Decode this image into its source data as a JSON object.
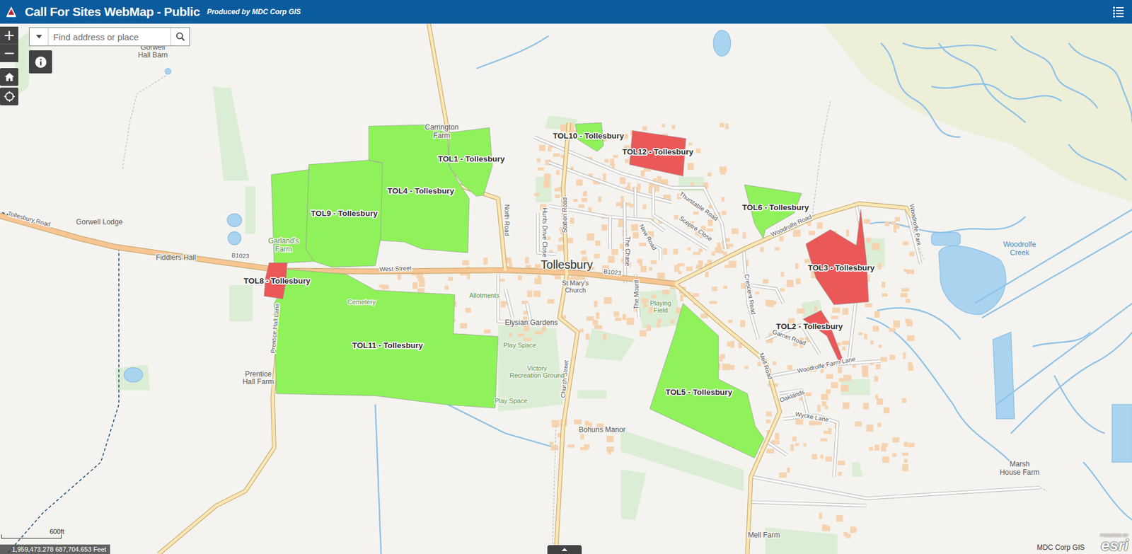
{
  "header": {
    "title": "Call For Sites WebMap - Public",
    "subtitle": "Produced by MDC Corp GIS"
  },
  "zoom": {
    "in": "+",
    "out": "−"
  },
  "search": {
    "placeholder": "Find address or place"
  },
  "sites": [
    {
      "label": "TOL1 - Tollesbury",
      "color": "#8ff25a"
    },
    {
      "label": "TOL4 - Tollesbury",
      "color": "#8ff25a"
    },
    {
      "label": "TOL9 - Tollesbury",
      "color": "#8ff25a"
    },
    {
      "label": "TOL11 - Tollesbury",
      "color": "#8ff25a"
    },
    {
      "label": "TOL8 - Tollesbury",
      "color": "#ea5858"
    },
    {
      "label": "TOL10 - Tollesbury",
      "color": "#8ff25a"
    },
    {
      "label": "TOL12 - Tollesbury",
      "color": "#ea5858"
    },
    {
      "label": "TOL6 - Tollesbury",
      "color": "#8ff25a"
    },
    {
      "label": "TOL3 - Tollesbury",
      "color": "#ea5858"
    },
    {
      "label": "TOL2 - Tollesbury",
      "color": "#ea5858"
    },
    {
      "label": "TOL5 - Tollesbury",
      "color": "#8ff25a"
    }
  ],
  "places": [
    {
      "lines": [
        "Gorwell",
        "Hall Barn"
      ],
      "color": "#5a5a5a"
    },
    {
      "lines": [
        "Carrington",
        "Farm"
      ],
      "color": "#5a5a5a"
    },
    {
      "lines": [
        "Gorwell Lodge"
      ],
      "color": "#5a5a5a"
    },
    {
      "lines": [
        "Fiddlers Hall"
      ],
      "color": "#5a5a5a"
    },
    {
      "lines": [
        "Garland's",
        "Farm"
      ],
      "color": "#5b9a4a"
    },
    {
      "lines": [
        "Tollesbury"
      ],
      "color": "#333333"
    },
    {
      "lines": [
        "St Mary's",
        "Church"
      ],
      "color": "#5a5a5a"
    },
    {
      "lines": [
        "Cemetery"
      ],
      "color": "#5b9a4a"
    },
    {
      "lines": [
        "Allotments"
      ],
      "color": "#5b9a4a"
    },
    {
      "lines": [
        "Elysian Gardens"
      ],
      "color": "#5a5a5a"
    },
    {
      "lines": [
        "Play Space"
      ],
      "color": "#5b9a4a"
    },
    {
      "lines": [
        "Victory",
        "Recreation Ground"
      ],
      "color": "#5b9a4a"
    },
    {
      "lines": [
        "Play Space"
      ],
      "color": "#5b9a4a"
    },
    {
      "lines": [
        "Playing",
        "Field"
      ],
      "color": "#5b9a4a"
    },
    {
      "lines": [
        "Bohuns Manor"
      ],
      "color": "#5a5a5a"
    },
    {
      "lines": [
        "Prentice",
        "Hall Farm"
      ],
      "color": "#5a5a5a"
    },
    {
      "lines": [
        "Mell Farm"
      ],
      "color": "#5a5a5a"
    },
    {
      "lines": [
        "Marsh",
        "House Farm"
      ],
      "color": "#5a5a5a"
    },
    {
      "lines": [
        "Woodrolfe",
        "Creek"
      ],
      "color": "#4a8cc0"
    }
  ],
  "roads": [
    "Tollesbury Road",
    "B1023",
    "West Street",
    "B1023",
    "North Road",
    "Station Road",
    "Hunts Drive Close",
    "The Chase",
    "New Road",
    "Thurstable Road",
    "Sceptre Close",
    "The Mount",
    "Crescent Road",
    "Woodrolfe Road",
    "Mell Road",
    "Garnet Road",
    "Woodrolfe Farm Lane",
    "Oaklands",
    "Wycke Lane",
    "Church Street",
    "Prentice Hall Lane",
    "Woodrolfe Park"
  ],
  "scale": {
    "label": "600ft"
  },
  "coordinates": "1,959,473.278 687,704.653 Feet",
  "attribution": "MDC Corp GIS",
  "esri": {
    "powered": "POWERED BY",
    "brand": "esri"
  }
}
